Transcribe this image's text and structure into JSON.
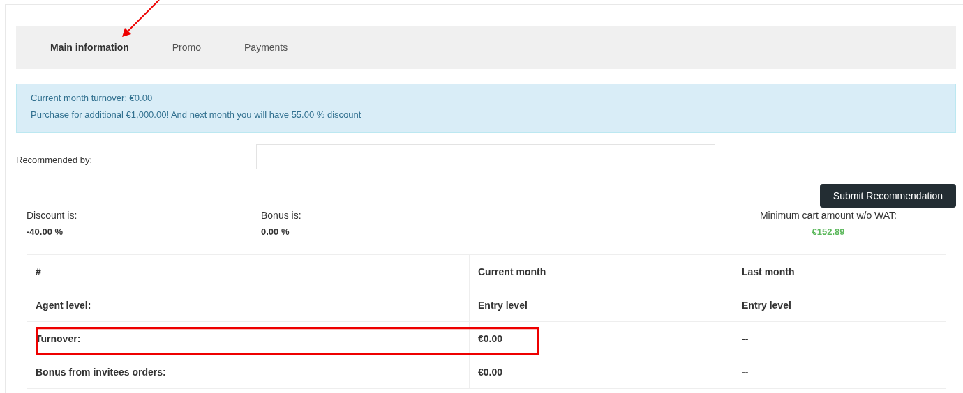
{
  "tabs": [
    {
      "label": "Main information",
      "selected": true
    },
    {
      "label": "Promo",
      "selected": false
    },
    {
      "label": "Payments",
      "selected": false
    }
  ],
  "info": {
    "lines": [
      "Current month turnover: €0.00",
      "Purchase for additional €1,000.00! And next month you will have 55.00 % discount"
    ]
  },
  "recommendation": {
    "label": "Recommended by:",
    "button": "Submit Recommendation"
  },
  "stats": [
    {
      "label": "Discount is:",
      "value": "-40.00 %",
      "kind": "plain"
    },
    {
      "label": "Bonus is:",
      "value": "0.00 %",
      "kind": "plain"
    },
    {
      "label": "Minimum cart amount w/o WAT:",
      "value": "€152.89",
      "kind": "highlight"
    }
  ],
  "table": {
    "columns": [
      "#",
      "Current month",
      "Last month"
    ],
    "rows": [
      [
        "Agent level:",
        "Entry level",
        "Entry level"
      ],
      [
        "Turnover:",
        "€0.00",
        "--"
      ],
      [
        "Bonus from invitees orders:",
        "€0.00",
        "--"
      ]
    ]
  }
}
